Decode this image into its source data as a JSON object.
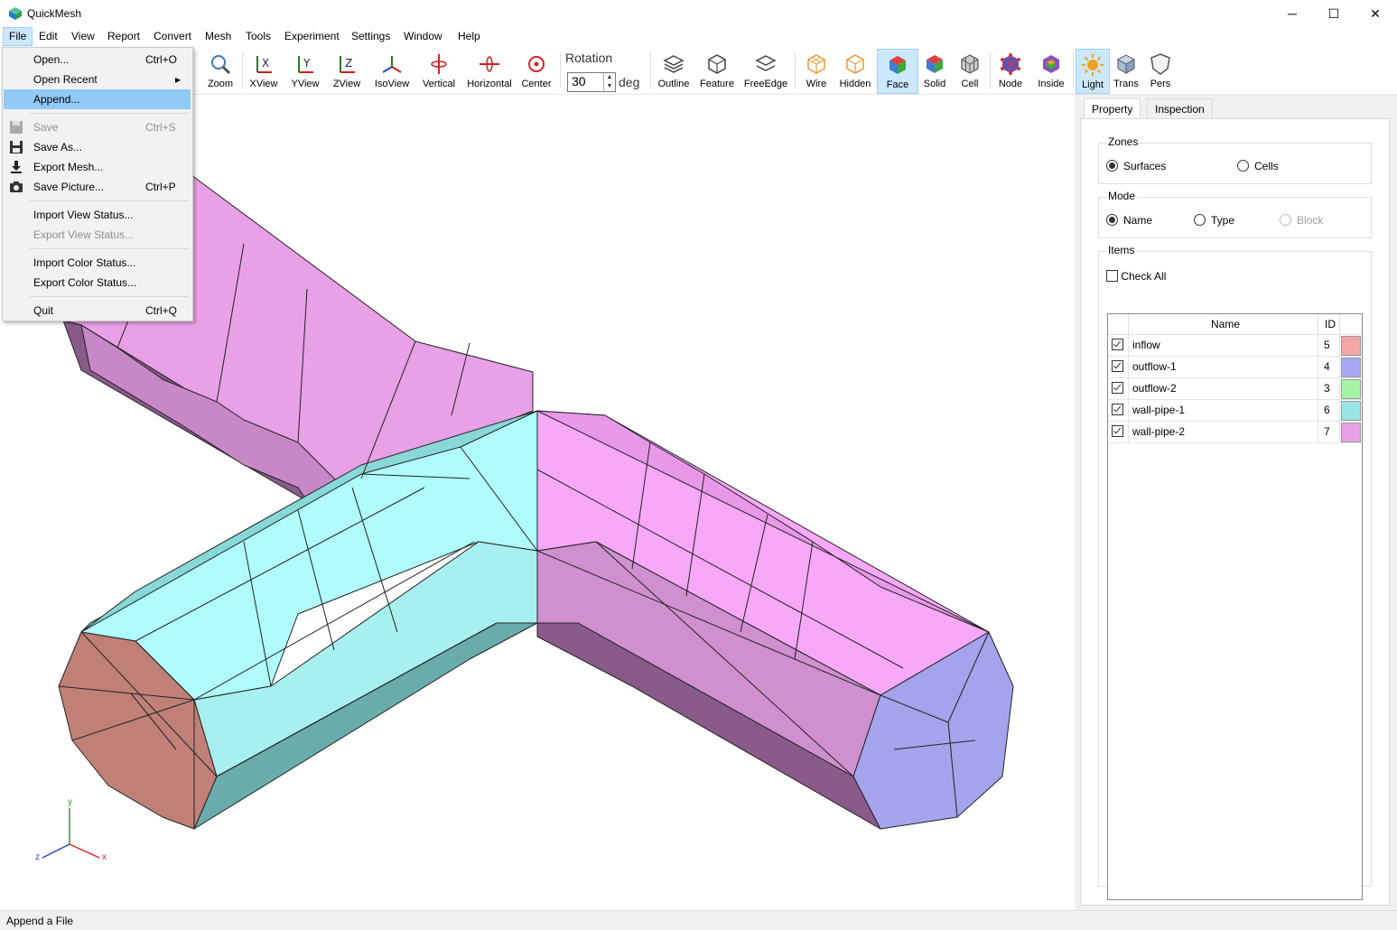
{
  "app": {
    "title": "QuickMesh"
  },
  "window": {
    "minimize": "─",
    "maximize": "☐",
    "close": "✕"
  },
  "menubar": [
    "File",
    "Edit",
    "View",
    "Report",
    "Convert",
    "Mesh",
    "Tools",
    "Experiment",
    "Settings",
    "Window",
    "Help"
  ],
  "toolbar": {
    "zoom": "Zoom",
    "xview": "XView",
    "yview": "YView",
    "zview": "ZView",
    "isoview": "IsoView",
    "vertical": "Vertical",
    "horizontal": "Horizontal",
    "center": "Center",
    "rotation_label": "Rotation",
    "rotation_value": "30",
    "rotation_unit": "deg",
    "outline": "Outline",
    "feature": "Feature",
    "freeedge": "FreeEdge",
    "wire": "Wire",
    "hidden": "Hidden",
    "face": "Face",
    "solid": "Solid",
    "cell": "Cell",
    "node": "Node",
    "inside": "Inside",
    "light": "Light",
    "trans": "Trans",
    "pers": "Pers"
  },
  "file_menu": [
    {
      "label": "Open...",
      "shortcut": "Ctrl+O"
    },
    {
      "label": "Open Recent",
      "shortcut": "▸"
    },
    {
      "label": "Append...",
      "shortcut": ""
    },
    {
      "label": "Save",
      "shortcut": "Ctrl+S"
    },
    {
      "label": "Save As...",
      "shortcut": ""
    },
    {
      "label": "Export Mesh...",
      "shortcut": ""
    },
    {
      "label": "Save Picture...",
      "shortcut": "Ctrl+P"
    },
    {
      "label": "Import View Status...",
      "shortcut": ""
    },
    {
      "label": "Export View Status...",
      "shortcut": ""
    },
    {
      "label": "Import Color Status...",
      "shortcut": ""
    },
    {
      "label": "Export Color Status...",
      "shortcut": ""
    },
    {
      "label": "Quit",
      "shortcut": "Ctrl+Q"
    }
  ],
  "panel": {
    "tabs": [
      "Property",
      "Inspection"
    ],
    "zones": {
      "label": "Zones",
      "surfaces": "Surfaces",
      "cells": "Cells"
    },
    "mode": {
      "label": "Mode",
      "name": "Name",
      "type": "Type",
      "block": "Block"
    },
    "items": {
      "label": "Items",
      "check_all": "Check All",
      "col_name": "Name",
      "col_id": "ID",
      "rows": [
        {
          "name": "inflow",
          "id": "5",
          "color": "#f4a7a7"
        },
        {
          "name": "outflow-1",
          "id": "4",
          "color": "#a7a7f4"
        },
        {
          "name": "outflow-2",
          "id": "3",
          "color": "#a7f4a7"
        },
        {
          "name": "wall-pipe-1",
          "id": "6",
          "color": "#98e6e6"
        },
        {
          "name": "wall-pipe-2",
          "id": "7",
          "color": "#e6a0e6"
        }
      ]
    }
  },
  "axes": {
    "x": "x",
    "y": "y",
    "z": "z"
  },
  "status": "Append a File"
}
